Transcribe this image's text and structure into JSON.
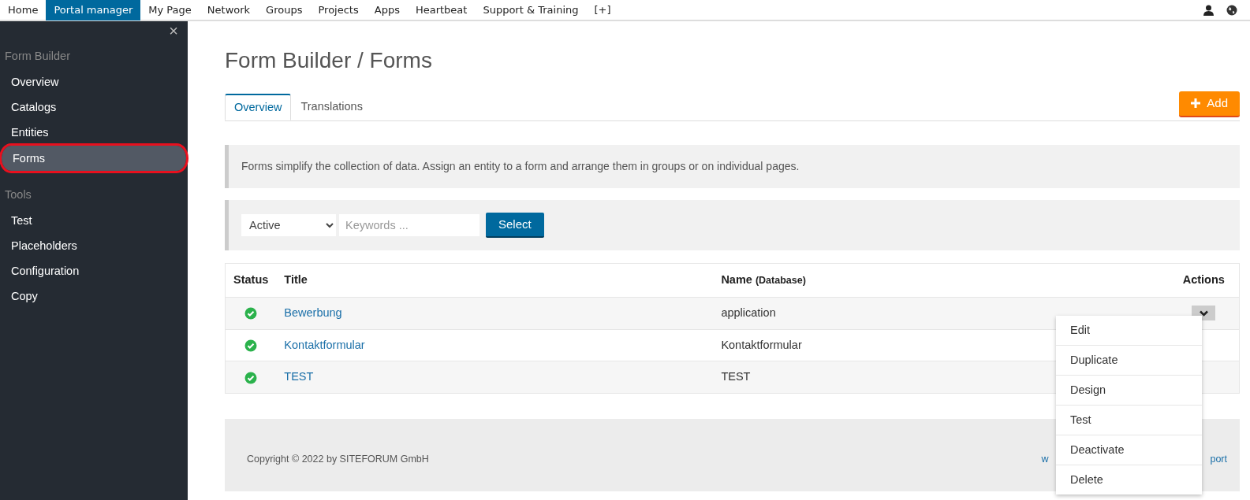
{
  "topnav": {
    "items": [
      {
        "label": "Home",
        "selected": false
      },
      {
        "label": "Portal manager",
        "selected": true
      },
      {
        "label": "My Page",
        "selected": false
      },
      {
        "label": "Network",
        "selected": false
      },
      {
        "label": "Groups",
        "selected": false
      },
      {
        "label": "Projects",
        "selected": false
      },
      {
        "label": "Apps",
        "selected": false
      },
      {
        "label": "Heartbeat",
        "selected": false
      },
      {
        "label": "Support & Training",
        "selected": false
      },
      {
        "label": "[+]",
        "selected": false
      }
    ]
  },
  "sidebar": {
    "close": "×",
    "sections": [
      {
        "heading": "Form Builder",
        "items": [
          {
            "label": "Overview",
            "selected": false,
            "highlighted": false
          },
          {
            "label": "Catalogs",
            "selected": false,
            "highlighted": false
          },
          {
            "label": "Entities",
            "selected": false,
            "highlighted": false
          },
          {
            "label": "Forms",
            "selected": true,
            "highlighted": true
          }
        ]
      },
      {
        "heading": "Tools",
        "items": [
          {
            "label": "Test",
            "selected": false,
            "highlighted": false
          },
          {
            "label": "Placeholders",
            "selected": false,
            "highlighted": false
          },
          {
            "label": "Configuration",
            "selected": false,
            "highlighted": false
          },
          {
            "label": "Copy",
            "selected": false,
            "highlighted": false
          }
        ]
      }
    ]
  },
  "page_title": "Form Builder / Forms",
  "tabs": [
    {
      "label": "Overview",
      "selected": true
    },
    {
      "label": "Translations",
      "selected": false
    }
  ],
  "add_button": "Add",
  "info_text": "Forms simplify the collection of data. Assign an entity to a form and arrange them in groups or on individual pages.",
  "filter": {
    "status_value": "Active",
    "keywords_placeholder": "Keywords ...",
    "select_button": "Select"
  },
  "table": {
    "columns": [
      {
        "label": "Status"
      },
      {
        "label": "Title"
      },
      {
        "label": "Name",
        "note": "(Database)"
      },
      {
        "label": "Actions"
      }
    ],
    "rows": [
      {
        "active": true,
        "title": "Bewerbung",
        "name": "application",
        "actions_toggle": true
      },
      {
        "active": true,
        "title": "Kontaktformular",
        "name": "Kontaktformular"
      },
      {
        "active": true,
        "title": "TEST",
        "name": "TEST"
      }
    ]
  },
  "action_menu": [
    "Edit",
    "Duplicate",
    "Design",
    "Test",
    "Deactivate",
    "Delete"
  ],
  "footer": {
    "copyright": "Copyright © 2022 by SITEFORUM GmbH",
    "link_start": "w",
    "link_end": "port"
  }
}
